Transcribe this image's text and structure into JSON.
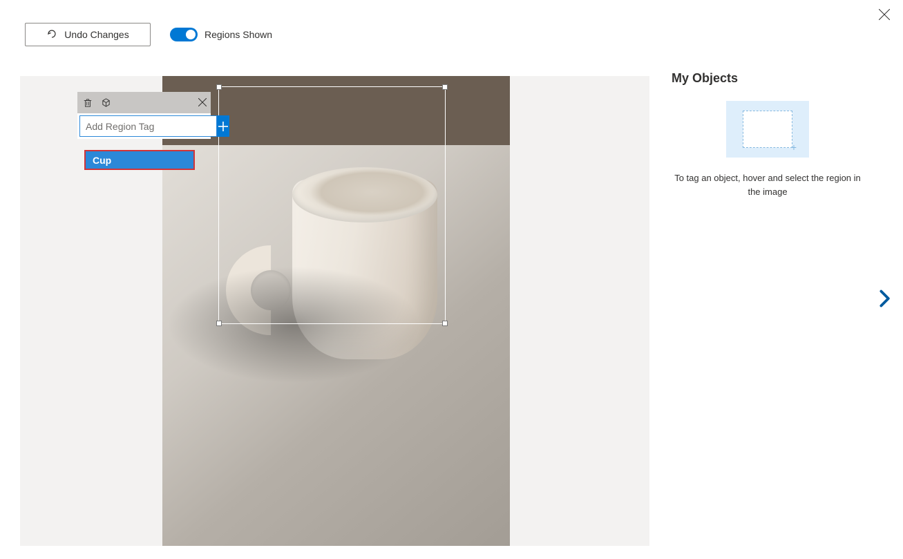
{
  "dialog": {
    "close_label": "Close"
  },
  "toolbar": {
    "undo_label": "Undo Changes",
    "toggle_label": "Regions Shown",
    "toggle_on": true
  },
  "tag_panel": {
    "input_placeholder": "Add Region Tag",
    "add_label": "+",
    "suggestions": [
      "Cup"
    ]
  },
  "side": {
    "title": "My Objects",
    "hint": "To tag an object, hover and select the region in the image"
  },
  "nav": {
    "next_label": "Next image"
  }
}
